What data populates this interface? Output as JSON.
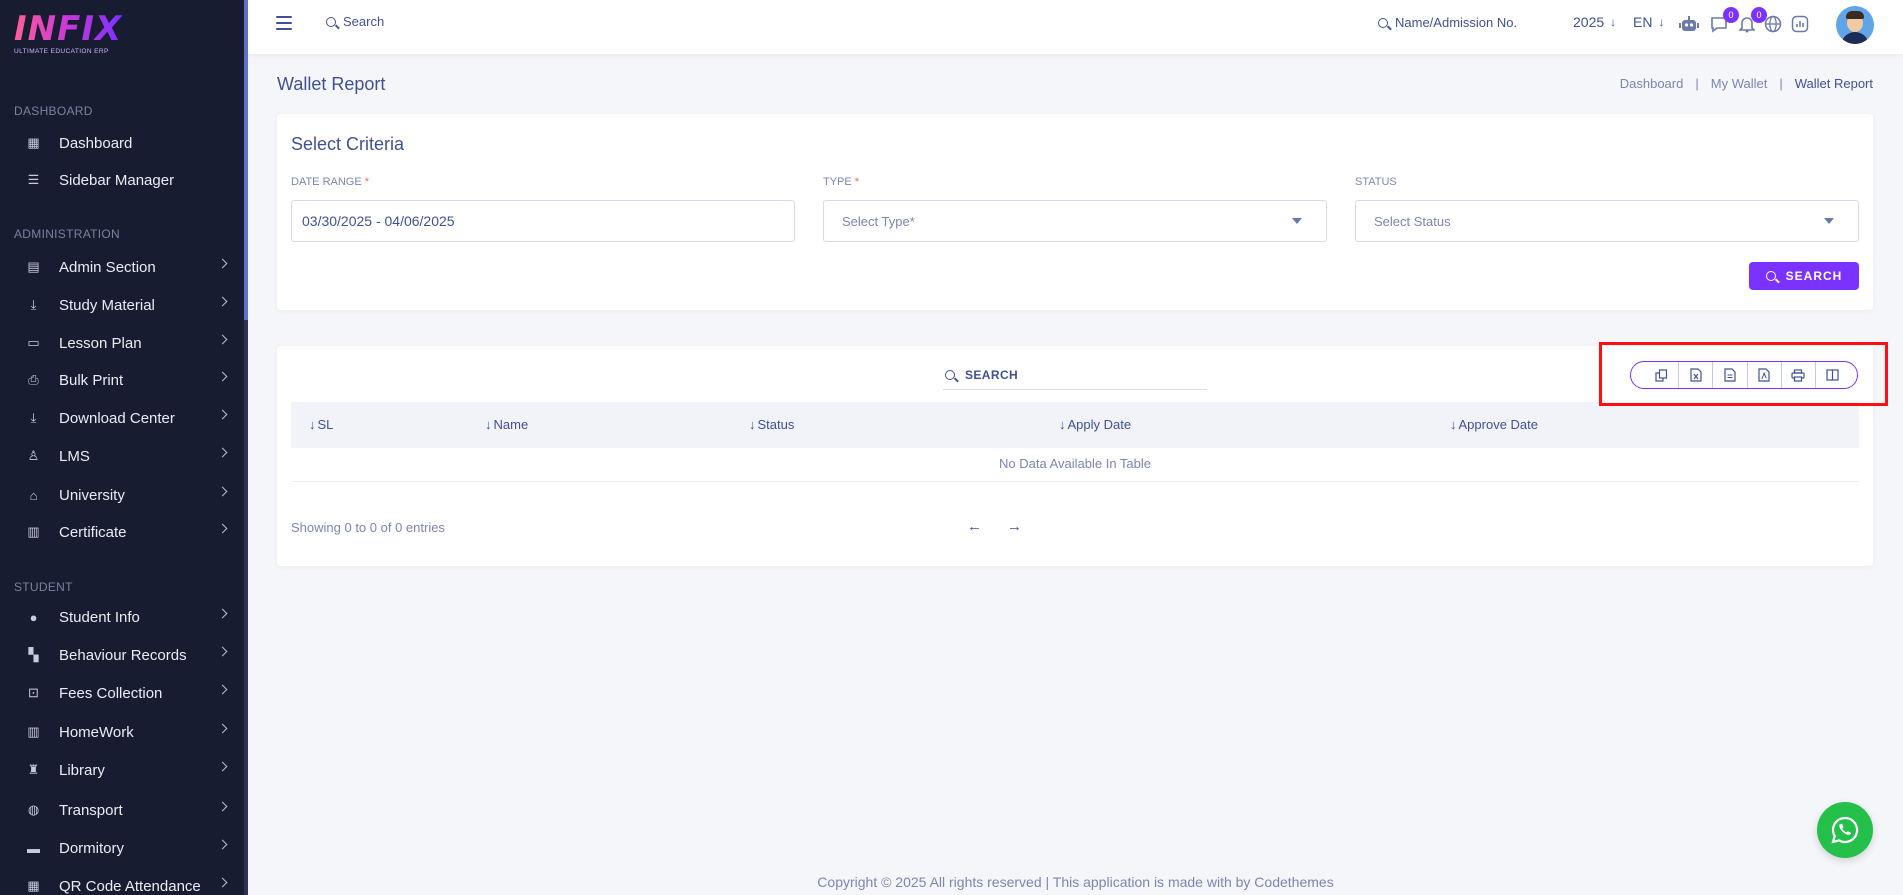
{
  "brand": {
    "logo": "INFIX",
    "tagline": "ULTIMATE EDUCATION ERP"
  },
  "sidebar": {
    "sections": [
      {
        "title": "DASHBOARD"
      },
      {
        "title": "ADMINISTRATION"
      },
      {
        "title": "STUDENT"
      }
    ],
    "items": [
      {
        "label": "Dashboard",
        "icon": "grid-icon"
      },
      {
        "label": "Sidebar Manager",
        "icon": "menu-icon"
      },
      {
        "label": "Admin Section",
        "icon": "admin-icon"
      },
      {
        "label": "Study Material",
        "icon": "download-icon"
      },
      {
        "label": "Lesson Plan",
        "icon": "lesson-icon"
      },
      {
        "label": "Bulk Print",
        "icon": "printer-icon"
      },
      {
        "label": "Download Center",
        "icon": "download-icon"
      },
      {
        "label": "LMS",
        "icon": "lms-icon"
      },
      {
        "label": "University",
        "icon": "university-icon"
      },
      {
        "label": "Certificate",
        "icon": "book-icon"
      },
      {
        "label": "Student Info",
        "icon": "user-icon"
      },
      {
        "label": "Behaviour Records",
        "icon": "records-icon"
      },
      {
        "label": "Fees Collection",
        "icon": "fees-icon"
      },
      {
        "label": "HomeWork",
        "icon": "book-icon"
      },
      {
        "label": "Library",
        "icon": "library-icon"
      },
      {
        "label": "Transport",
        "icon": "bus-icon"
      },
      {
        "label": "Dormitory",
        "icon": "bed-icon"
      },
      {
        "label": "QR Code Attendance",
        "icon": "qr-icon"
      }
    ]
  },
  "topbar": {
    "search_label": "Search",
    "name_search_label": "Name/Admission No.",
    "year": "2025",
    "language": "EN",
    "chat_badge": "0",
    "notification_badge": "0"
  },
  "header": {
    "title": "Wallet Report",
    "breadcrumb": [
      "Dashboard",
      "My Wallet",
      "Wallet Report"
    ],
    "separator": "|"
  },
  "criteria": {
    "title": "Select Criteria",
    "date_range_label": "DATE RANGE",
    "date_range_value": "03/30/2025 - 04/06/2025",
    "type_label": "TYPE",
    "type_placeholder": "Select Type*",
    "status_label": "STATUS",
    "status_placeholder": "Select Status",
    "required_mark": "*",
    "search_button": "SEARCH"
  },
  "table": {
    "search_label": "SEARCH",
    "export_buttons": [
      "copy-icon",
      "excel-icon",
      "csv-icon",
      "pdf-icon",
      "printer-icon",
      "columns-icon"
    ],
    "columns": [
      "SL",
      "Name",
      "Status",
      "Apply Date",
      "Approve Date"
    ],
    "empty_text": "No Data Available In Table",
    "info": "Showing 0 to 0 of 0 entries",
    "prev": "←",
    "next": "→"
  },
  "footer": {
    "text": "Copyright © 2025 All rights reserved | This application is made with by Codethemes"
  },
  "colors": {
    "accent": "#7c32ff",
    "text": "#415094",
    "sidebar": "#181c30",
    "highlight": "#ff0f0f",
    "whatsapp": "#25c04a"
  }
}
